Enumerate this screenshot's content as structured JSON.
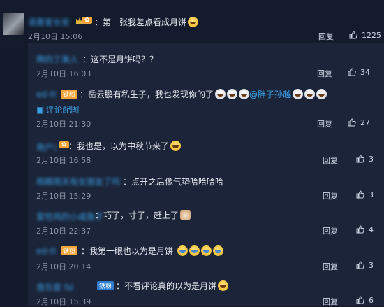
{
  "main_comment": {
    "username": "语菱爱长安",
    "text": "第一张我差点看成月饼",
    "time": "2月10日 15:06",
    "reply_label": "回复",
    "likes": "1225"
  },
  "replies": [
    {
      "username": "啊的丁美人",
      "text": "这不是月饼吗？？",
      "time": "2月10日 16:03",
      "reply_label": "回复",
      "likes": "34"
    },
    {
      "username": "ed-tt",
      "badge": "铁粉",
      "text_a": "岳云鹏有私生子，我也发现你的了",
      "mention": "@胖子孙越",
      "link_label": "评论配图",
      "time": "2月10日 21:30",
      "reply_label": "回复",
      "likes": "27"
    },
    {
      "username": "用户名",
      "badge": "",
      "text": "我也是，以为中秋节来了",
      "time": "2月10日 16:58",
      "reply_label": "回复",
      "likes": "3"
    },
    {
      "username": "雨睛雨天有女朋友了吗",
      "text": "点开之后像气垫哈哈哈哈",
      "time": "2月10日 15:29",
      "reply_label": "回复",
      "likes": "3"
    },
    {
      "username": "爱吃鸡的小咸鱼子",
      "text": "巧了，寸了，赶上了",
      "time": "2月10日 22:37",
      "reply_label": "回复",
      "likes": "4"
    },
    {
      "username": "ed-tt",
      "badge": "铁粉",
      "text": "我第一眼也以为是月饼",
      "time": "2月10日 20:14",
      "reply_label": "回复",
      "likes": "3"
    },
    {
      "username": "音乐家 fsl",
      "badge": "铁粉",
      "text": "不看评论真的以为是月饼",
      "time": "2月10日 15:39",
      "reply_label": "回复",
      "likes": "6"
    }
  ]
}
